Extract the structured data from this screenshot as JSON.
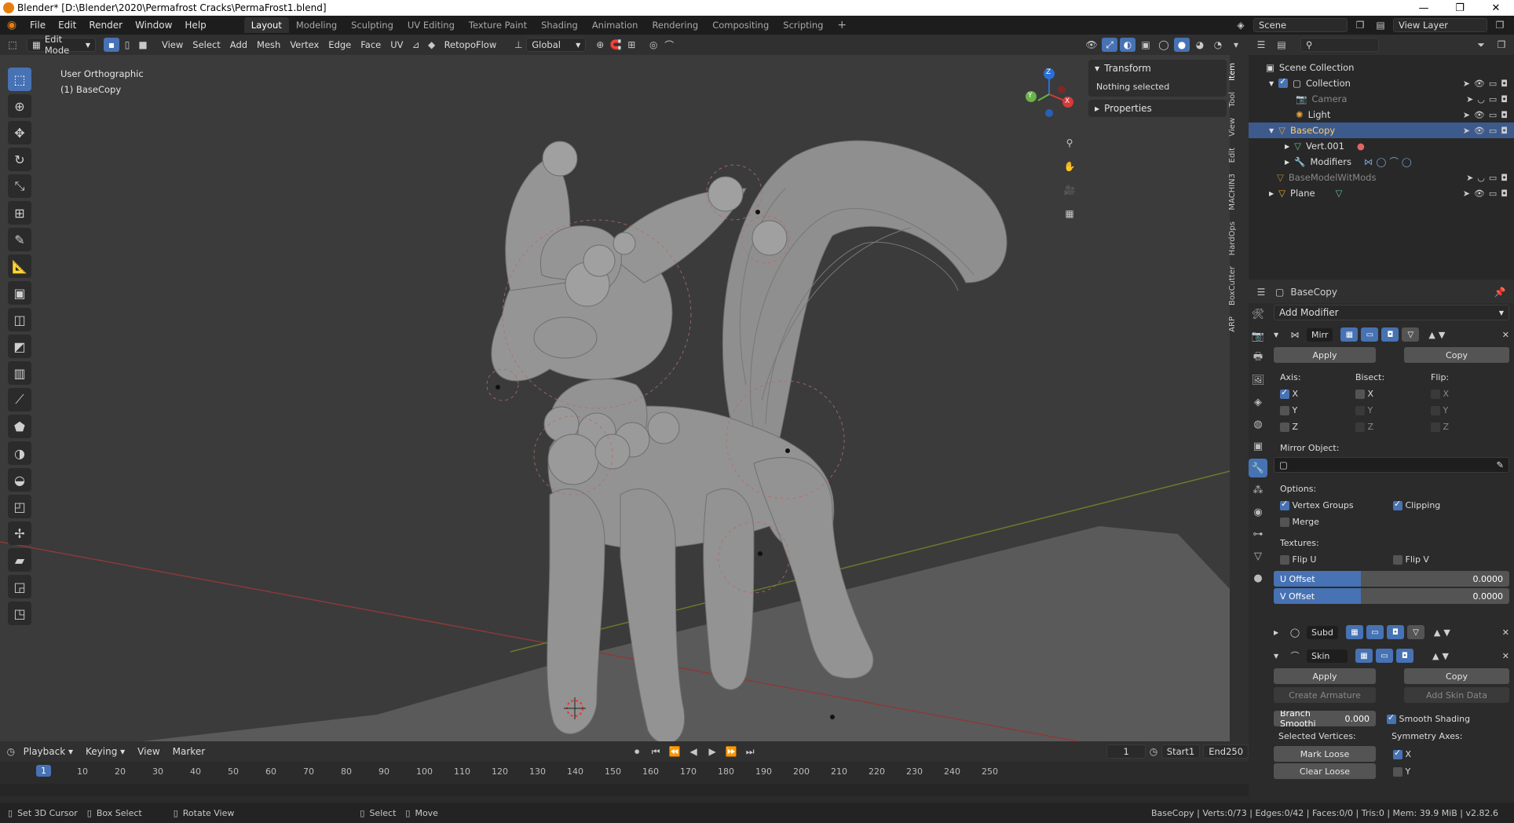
{
  "titlebar": {
    "title": "Blender* [D:\\Blender\\2020\\Permafrost Cracks\\PermaFrost1.blend]",
    "minimize": "—",
    "maximize": "❐",
    "close": "✕"
  },
  "menus": [
    "File",
    "Edit",
    "Render",
    "Window",
    "Help"
  ],
  "workspaces": [
    "Layout",
    "Modeling",
    "Sculpting",
    "UV Editing",
    "Texture Paint",
    "Shading",
    "Animation",
    "Rendering",
    "Compositing",
    "Scripting"
  ],
  "workspace_add": "+",
  "scene": {
    "label": "Scene",
    "view_layer": "View Layer"
  },
  "viewport_header": {
    "mode": "Edit Mode",
    "menus": [
      "View",
      "Select",
      "Add",
      "Mesh",
      "Vertex",
      "Edge",
      "Face",
      "UV"
    ],
    "addon": "RetopoFlow",
    "orientation": "Global"
  },
  "viewport": {
    "view_name": "User Orthographic",
    "object_name": "(1) BaseCopy",
    "gizmo_axes": [
      "X",
      "Y",
      "Z"
    ]
  },
  "npanel": {
    "transform_title": "Transform",
    "nothing_selected": "Nothing selected",
    "properties_title": "Properties",
    "tabs": [
      "Item",
      "Tool",
      "View",
      "Edit",
      "MACHIN3",
      "HardOps",
      "BoxCutter",
      "ARP"
    ]
  },
  "outliner": {
    "scene_collection": "Scene Collection",
    "items": [
      {
        "label": "Collection",
        "indent": 1
      },
      {
        "label": "Camera",
        "indent": 2
      },
      {
        "label": "Light",
        "indent": 2
      },
      {
        "label": "BaseCopy",
        "indent": 1
      },
      {
        "label": "Vert.001",
        "indent": 2
      },
      {
        "label": "Modifiers",
        "indent": 2
      },
      {
        "label": "BaseModelWitMods",
        "indent": 1
      },
      {
        "label": "Plane",
        "indent": 1
      }
    ]
  },
  "properties": {
    "object_name": "BaseCopy",
    "add_modifier": "Add Modifier",
    "mirror": {
      "name": "Mirr",
      "apply": "Apply",
      "copy": "Copy",
      "axis_label": "Axis:",
      "bisect_label": "Bisect:",
      "flip_label": "Flip:",
      "axes": [
        "X",
        "Y",
        "Z"
      ],
      "mirror_object_label": "Mirror Object:",
      "options_label": "Options:",
      "vertex_groups": "Vertex Groups",
      "clipping": "Clipping",
      "merge": "Merge",
      "textures_label": "Textures:",
      "flip_u": "Flip U",
      "flip_v": "Flip V",
      "u_offset_label": "U Offset",
      "u_offset_value": "0.0000",
      "v_offset_label": "V Offset",
      "v_offset_value": "0.0000"
    },
    "subd": {
      "name": "Subd"
    },
    "skin": {
      "name": "Skin",
      "apply": "Apply",
      "copy": "Copy",
      "create_armature": "Create Armature",
      "add_skin_data": "Add Skin Data",
      "branch_smoothing_label": "Branch Smoothi",
      "branch_smoothing_value": "0.000",
      "smooth_shading": "Smooth Shading",
      "selected_vertices": "Selected Vertices:",
      "symmetry_axes": "Symmetry Axes:",
      "mark_loose": "Mark Loose",
      "clear_loose": "Clear Loose",
      "sym_x": "X",
      "sym_y": "Y"
    }
  },
  "timeline": {
    "menus": [
      "Playback",
      "Keying",
      "View",
      "Marker"
    ],
    "current_frame": "1",
    "start_label": "Start",
    "start_value": "1",
    "end_label": "End",
    "end_value": "250",
    "ticks": [
      "10",
      "20",
      "30",
      "40",
      "50",
      "60",
      "70",
      "80",
      "90",
      "100",
      "110",
      "120",
      "130",
      "140",
      "150",
      "160",
      "170",
      "180",
      "190",
      "200",
      "210",
      "220",
      "230",
      "240",
      "250"
    ],
    "playhead": "1"
  },
  "statusbar": {
    "hint1": "Set 3D Cursor",
    "hint2": "Box Select",
    "hint3": "Rotate View",
    "hint4": "Select",
    "hint5": "Move",
    "stats": "BaseCopy | Verts:0/73 | Edges:0/42 | Faces:0/0 | Tris:0 | Mem: 39.9 MiB | v2.82.6"
  },
  "colors": {
    "accent": "#4772b3",
    "selected": "#3d5a8c",
    "viewport_bg": "#3b3b3b"
  }
}
